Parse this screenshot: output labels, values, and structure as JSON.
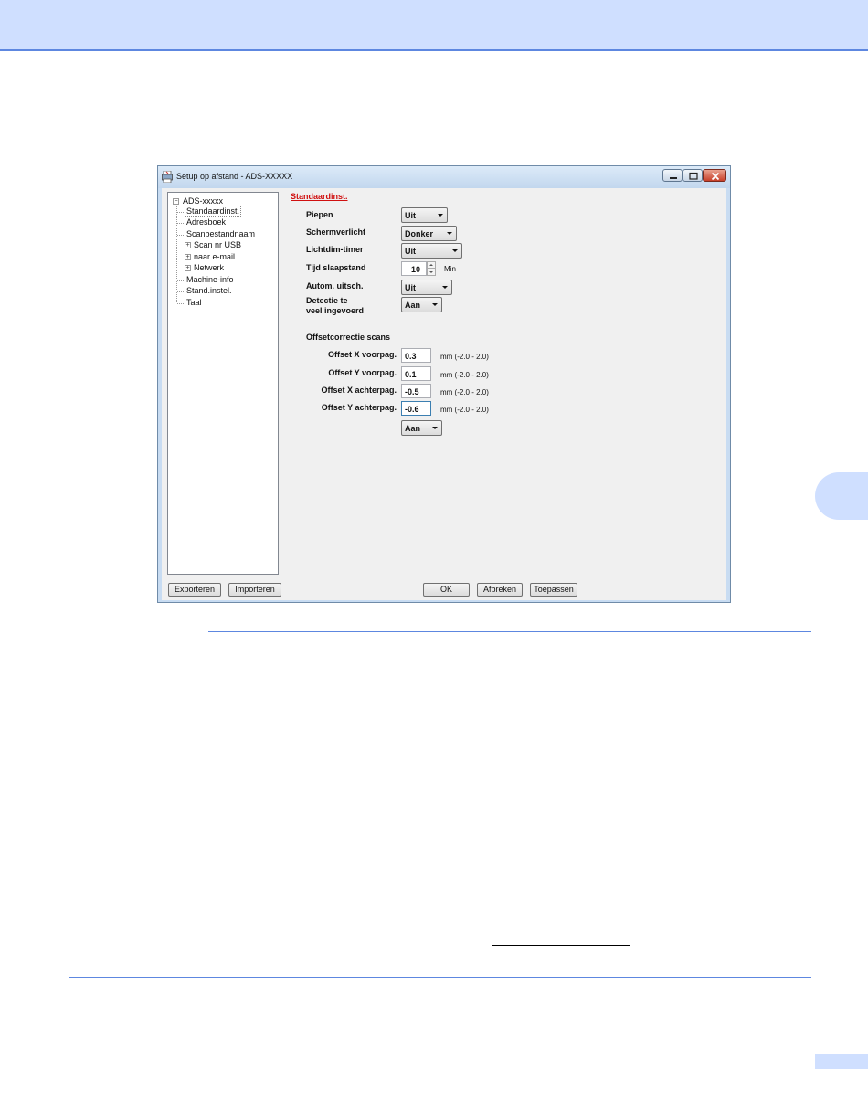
{
  "window": {
    "title": "Setup op afstand - ADS-XXXXX"
  },
  "tree": {
    "root": "ADS-xxxxx",
    "items": [
      {
        "label": "Standaardinst.",
        "expandable": false,
        "selected": true
      },
      {
        "label": "Adresboek",
        "expandable": false
      },
      {
        "label": "Scanbestandnaam",
        "expandable": false
      },
      {
        "label": "Scan nr USB",
        "expandable": true
      },
      {
        "label": "naar e-mail",
        "expandable": true
      },
      {
        "label": "Netwerk",
        "expandable": true
      },
      {
        "label": "Machine-info",
        "expandable": false
      },
      {
        "label": "Stand.instel.",
        "expandable": false
      },
      {
        "label": "Taal",
        "expandable": false
      }
    ]
  },
  "form": {
    "section_title": "Standaardinst.",
    "piepen": {
      "label": "Piepen",
      "value": "Uit"
    },
    "schermverlicht": {
      "label": "Schermverlicht",
      "value": "Donker"
    },
    "lichtdim": {
      "label": "Lichtdim-timer",
      "value": "Uit"
    },
    "slaapstand": {
      "label": "Tijd slaapstand",
      "value": "10",
      "unit": "Min"
    },
    "autom": {
      "label": "Autom. uitsch.",
      "value": "Uit"
    },
    "detectie": {
      "label_line1": "Detectie te",
      "label_line2": "veel ingevoerd",
      "value": "Aan"
    },
    "offset_title": "Offsetcorrectie scans",
    "offsets": [
      {
        "label": "Offset X voorpag.",
        "value": "0.3",
        "range": "mm (-2.0 - 2.0)"
      },
      {
        "label": "Offset Y voorpag.",
        "value": "0.1",
        "range": "mm (-2.0 - 2.0)"
      },
      {
        "label": "Offset X achterpag.",
        "value": "-0.5",
        "range": "mm (-2.0 - 2.0)"
      },
      {
        "label": "Offset Y achterpag.",
        "value": "-0.6",
        "range": "mm (-2.0 - 2.0)"
      }
    ],
    "offset_toggle": "Aan"
  },
  "buttons": {
    "export": "Exporteren",
    "import": "Importeren",
    "ok": "OK",
    "cancel": "Afbreken",
    "apply": "Toepassen"
  },
  "colors": {
    "page_accent": "#5d87e0",
    "page_band": "#cfdfff",
    "section_title": "#d01010"
  }
}
